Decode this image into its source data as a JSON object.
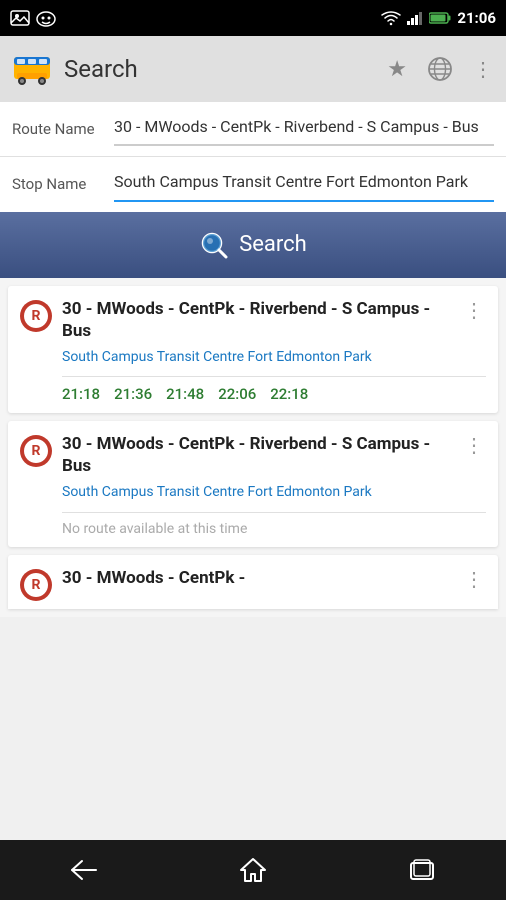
{
  "statusBar": {
    "time": "21:06",
    "icons": [
      "wifi",
      "signal",
      "battery"
    ]
  },
  "appBar": {
    "title": "Search",
    "icons": {
      "star": "★",
      "globe": "🌐",
      "dots": "⋮"
    }
  },
  "form": {
    "routeLabel": "Route Name",
    "routeValue": "30 - MWoods - CentPk - Riverbend - S Campus - Bus",
    "stopLabel": "Stop Name",
    "stopValue": "South Campus Transit Centre Fort Edmonton Park"
  },
  "searchButton": {
    "label": "Search"
  },
  "results": [
    {
      "routeName": "30 - MWoods - CentPk - Riverbend - S Campus - Bus",
      "stopName": "South Campus Transit Centre Fort Edmonton Park",
      "times": [
        "21:18",
        "21:36",
        "21:48",
        "22:06",
        "22:18"
      ],
      "noRoute": false
    },
    {
      "routeName": "30 - MWoods - CentPk - Riverbend - S Campus - Bus",
      "stopName": "South Campus Transit Centre Fort Edmonton Park",
      "times": [],
      "noRoute": true,
      "noRouteText": "No route available at this time"
    },
    {
      "routeName": "30 - MWoods - CentPk -",
      "stopName": "",
      "times": [],
      "noRoute": false,
      "partial": true
    }
  ],
  "nav": {
    "back": "←",
    "home": "⌂",
    "recent": "▭"
  },
  "colors": {
    "accent": "#2196F3",
    "green": "#2e7d32",
    "routeRed": "#c0392b",
    "searchBg": "#3a4f80",
    "navBg": "#1a1a1a"
  }
}
